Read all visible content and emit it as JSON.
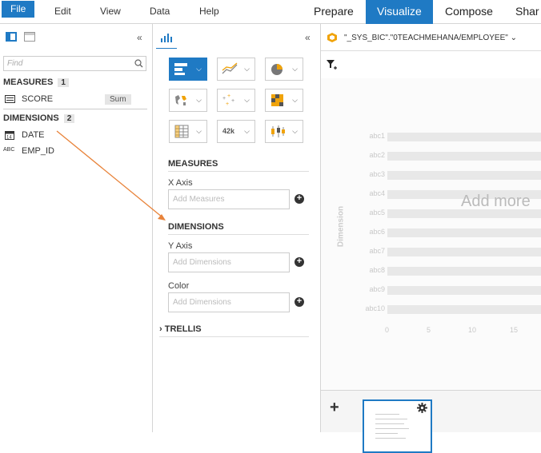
{
  "menu": {
    "file": "File",
    "edit": "Edit",
    "view": "View",
    "data": "Data",
    "help": "Help"
  },
  "modes": {
    "prepare": "Prepare",
    "visualize": "Visualize",
    "compose": "Compose",
    "share": "Shar"
  },
  "left": {
    "search_placeholder": "Find",
    "measures_title": "MEASURES",
    "measures_count": "1",
    "measures": [
      {
        "name": "SCORE",
        "aggregation": "Sum",
        "icon": "measure-icon"
      }
    ],
    "dimensions_title": "DIMENSIONS",
    "dimensions_count": "2",
    "dimensions": [
      {
        "name": "DATE",
        "icon": "calendar-icon"
      },
      {
        "name": "EMP_ID",
        "icon": "abc-icon",
        "type_label": "ABC"
      }
    ]
  },
  "builder": {
    "measures_heading": "MEASURES",
    "x_axis_label": "X Axis",
    "x_axis_placeholder": "Add Measures",
    "dimensions_heading": "DIMENSIONS",
    "y_axis_label": "Y Axis",
    "y_axis_placeholder": "Add Dimensions",
    "color_label": "Color",
    "color_placeholder": "Add Dimensions",
    "trellis_label": "TRELLIS",
    "numeric_chart_label": "42k"
  },
  "dataset": {
    "name": "\"_SYS_BIC\".\"0TEACHMEHANA/EMPLOYEE\""
  },
  "canvas": {
    "placeholder_text": "Add more",
    "axis_title": "Dimension",
    "categories": [
      "abc1",
      "abc2",
      "abc3",
      "abc4",
      "abc5",
      "abc6",
      "abc7",
      "abc8",
      "abc9",
      "abc10"
    ],
    "x_ticks": [
      "0",
      "5",
      "10",
      "15"
    ]
  },
  "colors": {
    "accent": "#1f7ac4",
    "arrow": "#e8833a",
    "hana_orange": "#f0a30a"
  }
}
